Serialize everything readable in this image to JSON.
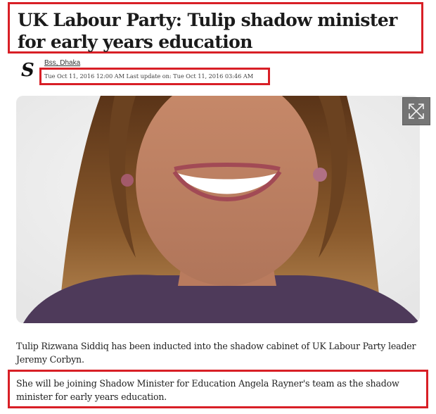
{
  "article": {
    "headline": "UK Labour Party: Tulip shadow minister for early years education",
    "byline": "Bss, Dhaka",
    "publisher_logo_glyph": "S",
    "dateline": "Tue Oct 11, 2016 12:00 AM Last update on: Tue Oct 11, 2016 03:46 AM",
    "paragraphs": [
      "Tulip Rizwana Siddiq has been inducted into the shadow cabinet of UK Labour Party leader Jeremy Corbyn.",
      "She will be joining Shadow Minister for Education Angela Rayner's team as the shadow minister for early years education."
    ]
  },
  "media": {
    "expand_icon": "expand-arrows-icon"
  },
  "colors": {
    "highlight": "#d81f26",
    "text": "#1a1a1a",
    "expand_button": "#5f5f5f"
  }
}
